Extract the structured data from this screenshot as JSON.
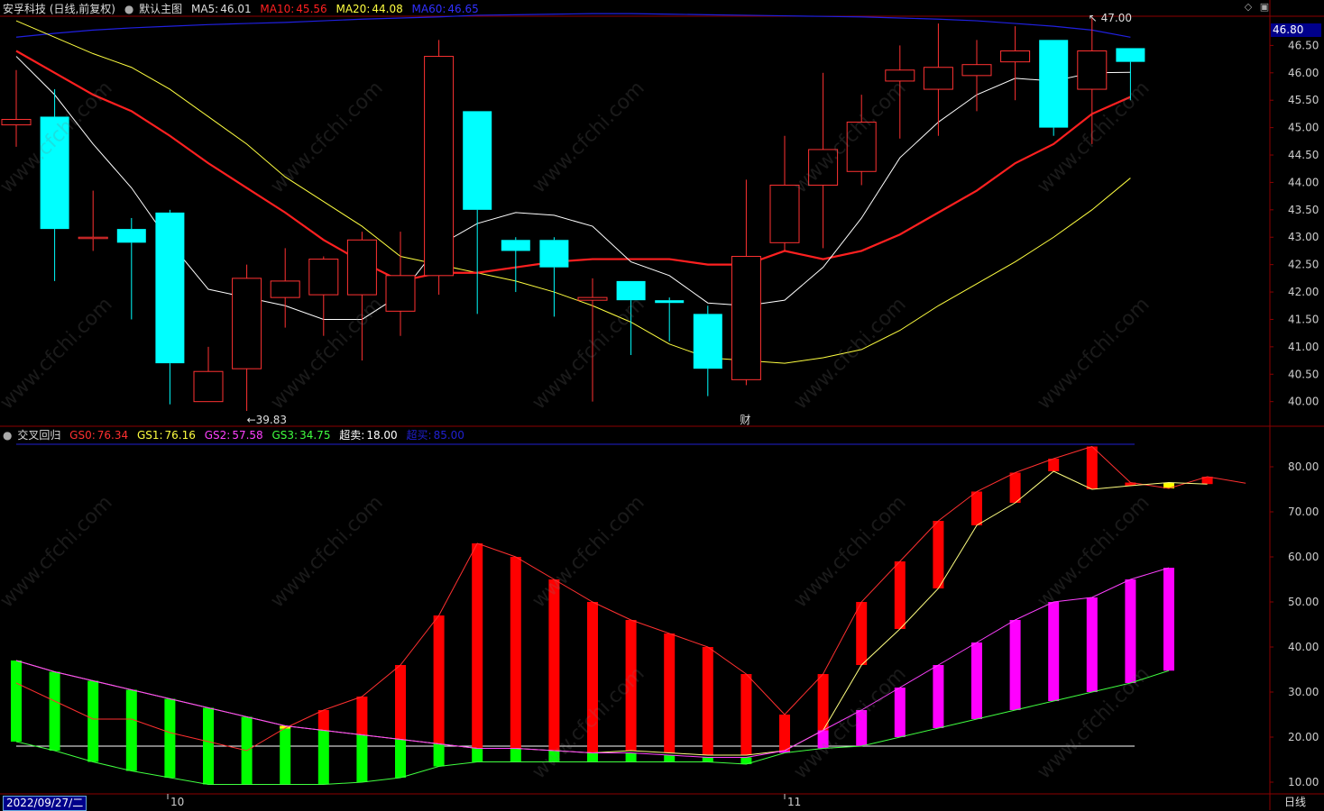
{
  "top_header": {
    "stock_name": "安孚科技 (日线,前复权)",
    "template": "默认主图",
    "ma5_label": "MA5:",
    "ma5_value": "46.01",
    "ma10_label": "MA10:",
    "ma10_value": "45.56",
    "ma20_label": "MA20:",
    "ma20_value": "44.08",
    "ma60_label": "MA60:",
    "ma60_value": "46.65"
  },
  "bottom_header": {
    "indicator": "交叉回归",
    "gs0_label": "GS0:",
    "gs0_value": "76.34",
    "gs1_label": "GS1:",
    "gs1_value": "76.16",
    "gs2_label": "GS2:",
    "gs2_value": "57.58",
    "gs3_label": "GS3:",
    "gs3_value": "34.75",
    "oversold_label": "超卖:",
    "oversold_value": "18.00",
    "overbought_label": "超买:",
    "overbought_value": "85.00"
  },
  "colors": {
    "up": "#ff3232",
    "down": "#00ffff",
    "ma5": "#ffffff",
    "ma10": "#ff2020",
    "ma20": "#ffff40",
    "ma60": "#2020e0",
    "gs_red": "#ff0000",
    "gs_yellow": "#ffff00",
    "gs_green": "#00ff00",
    "gs_magenta": "#ff00ff",
    "grid": "#8b0000"
  },
  "price_axis": {
    "ticks": [
      "40.00",
      "40.50",
      "41.00",
      "41.50",
      "42.00",
      "42.50",
      "43.00",
      "43.50",
      "44.00",
      "44.50",
      "45.00",
      "45.50",
      "46.00",
      "46.50"
    ],
    "current_price": "46.80"
  },
  "indicator_axis": {
    "ticks": [
      "10.00",
      "20.00",
      "30.00",
      "40.00",
      "50.00",
      "60.00",
      "70.00",
      "80.00"
    ]
  },
  "annotations": {
    "high": "47.00",
    "low": "39.83",
    "finance_marker": "财"
  },
  "bottom_bar": {
    "cursor_date": "2022/09/27/二",
    "month_oct": "10",
    "month_nov": "11",
    "period": "日线"
  },
  "icons": [
    "circle-icon",
    "diamond-icon",
    "box-icon"
  ],
  "watermark": "www.cfchi.com",
  "chart_data": [
    {
      "type": "candlestick",
      "title": "安孚科技 (日线,前复权)",
      "ylim": [
        39.6,
        47.0
      ],
      "candles": [
        {
          "o": 45.05,
          "h": 46.05,
          "l": 44.65,
          "c": 45.15
        },
        {
          "o": 45.2,
          "h": 45.7,
          "l": 42.2,
          "c": 43.15
        },
        {
          "o": 43.0,
          "h": 43.85,
          "l": 42.75,
          "c": 43.0
        },
        {
          "o": 43.15,
          "h": 43.35,
          "l": 41.5,
          "c": 42.9
        },
        {
          "o": 43.45,
          "h": 43.5,
          "l": 39.95,
          "c": 40.7
        },
        {
          "o": 40.0,
          "h": 41.0,
          "l": 40.0,
          "c": 40.55
        },
        {
          "o": 40.6,
          "h": 42.5,
          "l": 39.83,
          "c": 42.25
        },
        {
          "o": 41.9,
          "h": 42.8,
          "l": 41.35,
          "c": 42.2
        },
        {
          "o": 41.95,
          "h": 42.65,
          "l": 41.2,
          "c": 42.6
        },
        {
          "o": 41.95,
          "h": 43.1,
          "l": 40.75,
          "c": 42.95
        },
        {
          "o": 41.65,
          "h": 43.1,
          "l": 41.2,
          "c": 42.3
        },
        {
          "o": 42.3,
          "h": 46.6,
          "l": 41.95,
          "c": 46.3
        },
        {
          "o": 45.3,
          "h": 45.3,
          "l": 41.6,
          "c": 43.5
        },
        {
          "o": 42.95,
          "h": 43.0,
          "l": 42.0,
          "c": 42.75
        },
        {
          "o": 42.95,
          "h": 43.0,
          "l": 41.55,
          "c": 42.45
        },
        {
          "o": 41.85,
          "h": 42.25,
          "l": 40.0,
          "c": 41.9
        },
        {
          "o": 42.2,
          "h": 42.2,
          "l": 40.85,
          "c": 41.85
        },
        {
          "o": 41.85,
          "h": 41.9,
          "l": 41.1,
          "c": 41.8
        },
        {
          "o": 41.6,
          "h": 41.75,
          "l": 40.1,
          "c": 40.6
        },
        {
          "o": 40.4,
          "h": 44.05,
          "l": 40.3,
          "c": 42.65
        },
        {
          "o": 42.9,
          "h": 44.85,
          "l": 42.75,
          "c": 43.95
        },
        {
          "o": 43.95,
          "h": 46.0,
          "l": 42.8,
          "c": 44.6
        },
        {
          "o": 44.2,
          "h": 45.6,
          "l": 43.95,
          "c": 45.1
        },
        {
          "o": 45.85,
          "h": 46.5,
          "l": 44.8,
          "c": 46.05
        },
        {
          "o": 45.7,
          "h": 46.9,
          "l": 44.85,
          "c": 46.1
        },
        {
          "o": 45.95,
          "h": 46.6,
          "l": 45.3,
          "c": 46.15
        },
        {
          "o": 46.2,
          "h": 46.85,
          "l": 45.5,
          "c": 46.4
        },
        {
          "o": 46.6,
          "h": 46.6,
          "l": 44.85,
          "c": 45.0
        },
        {
          "o": 45.7,
          "h": 47.0,
          "l": 44.7,
          "c": 46.4
        },
        {
          "o": 46.45,
          "h": 46.45,
          "l": 45.5,
          "c": 46.2
        }
      ],
      "series": [
        {
          "name": "MA5",
          "values": [
            46.3,
            45.6,
            44.7,
            43.9,
            42.9,
            42.05,
            41.9,
            41.75,
            41.5,
            41.5,
            41.95,
            42.85,
            43.25,
            43.45,
            43.4,
            43.2,
            42.55,
            42.3,
            41.8,
            41.75,
            41.85,
            42.45,
            43.35,
            44.45,
            45.1,
            45.6,
            45.9,
            45.85,
            46.0,
            46.01
          ]
        },
        {
          "name": "MA10",
          "values": [
            46.4,
            46.0,
            45.6,
            45.3,
            44.85,
            44.35,
            43.9,
            43.45,
            42.95,
            42.55,
            42.2,
            42.35,
            42.35,
            42.45,
            42.55,
            42.6,
            42.6,
            42.6,
            42.5,
            42.5,
            42.75,
            42.6,
            42.75,
            43.05,
            43.45,
            43.85,
            44.35,
            44.7,
            45.25,
            45.56
          ]
        },
        {
          "name": "MA20",
          "values": [
            46.95,
            46.65,
            46.35,
            46.1,
            45.7,
            45.2,
            44.7,
            44.1,
            43.65,
            43.2,
            42.65,
            42.5,
            42.35,
            42.2,
            42.0,
            41.75,
            41.45,
            41.05,
            40.8,
            40.75,
            40.7,
            40.8,
            40.95,
            41.3,
            41.75,
            42.15,
            42.55,
            43.0,
            43.5,
            44.08
          ]
        },
        {
          "name": "MA60",
          "values": [
            46.65,
            46.72,
            46.78,
            46.82,
            46.85,
            46.88,
            46.9,
            46.92,
            46.95,
            46.98,
            47.0,
            47.02,
            47.05,
            47.06,
            47.07,
            47.08,
            47.08,
            47.07,
            47.06,
            47.05,
            47.04,
            47.03,
            47.02,
            47.0,
            46.98,
            46.95,
            46.9,
            46.85,
            46.78,
            46.65
          ]
        }
      ]
    },
    {
      "type": "bar",
      "title": "交叉回归",
      "ylim": [
        8,
        88
      ],
      "series": [
        {
          "name": "GS0",
          "values": [
            32,
            28,
            24,
            24,
            21,
            19,
            17,
            22,
            26,
            29,
            36,
            47,
            63,
            60,
            55,
            50,
            46,
            43,
            40,
            34,
            25,
            34,
            50,
            59,
            68,
            74.5,
            78.7,
            81.8,
            84.5,
            76.5,
            75.2,
            77.8,
            76.34
          ]
        },
        {
          "name": "GS1",
          "values": [
            37,
            34.5,
            32.5,
            30.5,
            28.5,
            26.5,
            24.5,
            22.5,
            21.5,
            20.5,
            19.5,
            18.5,
            17.5,
            17.5,
            17,
            16.5,
            17,
            16.5,
            16,
            16,
            17,
            21.5,
            36,
            44,
            53,
            67,
            72,
            79,
            75,
            75.8,
            76.5,
            76.16
          ]
        },
        {
          "name": "GS2",
          "values": [
            37,
            34.5,
            32.5,
            30.5,
            28.5,
            26.5,
            24.5,
            22.5,
            21.5,
            20.5,
            19.5,
            18.5,
            17.5,
            17.5,
            17,
            16.5,
            16.5,
            16,
            15.5,
            15.5,
            17,
            21.5,
            26,
            31,
            36,
            41,
            46,
            50,
            51,
            55,
            57.58
          ]
        },
        {
          "name": "GS3",
          "values": [
            19,
            17,
            14.5,
            12.5,
            11,
            9.5,
            9.5,
            9.5,
            9.5,
            10,
            11,
            13.5,
            14.5,
            14.5,
            14.5,
            14.5,
            14.5,
            14.5,
            14.5,
            14,
            16.5,
            17.5,
            18,
            20,
            22,
            24,
            26,
            28,
            30,
            32,
            34.75
          ]
        }
      ],
      "reference_lines": [
        {
          "name": "超卖",
          "value": 18.0
        },
        {
          "name": "超买",
          "value": 85.0
        }
      ]
    }
  ]
}
